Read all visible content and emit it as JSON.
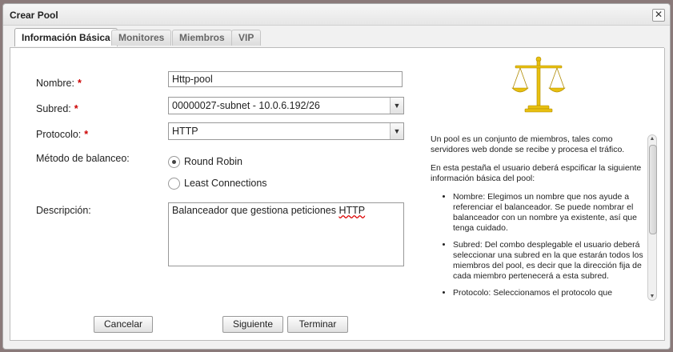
{
  "dialog": {
    "title": "Crear Pool",
    "close_glyph": "✕"
  },
  "tabs": [
    {
      "label": "Información Básica",
      "active": true
    },
    {
      "label": "Monitores"
    },
    {
      "label": "Miembros"
    },
    {
      "label": "VIP"
    }
  ],
  "form": {
    "nombre_label": "Nombre:",
    "nombre_value": "Http-pool",
    "subred_label": "Subred:",
    "subred_value": "00000027-subnet - 10.0.6.192/26",
    "protocolo_label": "Protocolo:",
    "protocolo_value": "HTTP",
    "metodo_label": "Método de balanceo:",
    "radio_round_robin": "Round Robin",
    "radio_least_connections": "Least Connections",
    "descripcion_label": "Descripción:",
    "descripcion_value_prefix": "Balanceador que gestiona peticiones ",
    "descripcion_value_misspelled": "HTTP",
    "required_mark": "*"
  },
  "help": {
    "intro": "Un pool es un conjunto de miembros, tales como servidores web donde se recibe y procesa el tráfico.",
    "tab_intro": "En esta pestaña el usuario deberá espcificar la siguiente información básica del pool:",
    "bullets": [
      "Nombre: Elegimos un nombre que nos ayude a referenciar el balanceador. Se puede nombrar el balanceador con un nombre ya existente, así que tenga cuidado.",
      "Subred: Del combo desplegable el usuario deberá seleccionar una subred en la que estarán todos los miembros del pool, es decir que la dirección fija de cada miembro pertenecerá a esta subred.",
      "Protocolo: Seleccionamos el protocolo que"
    ]
  },
  "buttons": {
    "cancel": "Cancelar",
    "next": "Siguiente",
    "finish": "Terminar"
  },
  "colors": {
    "required": "#cc0000",
    "scale_gold": "#e8c010"
  },
  "icons": {
    "scale": "balance-scale-icon"
  }
}
